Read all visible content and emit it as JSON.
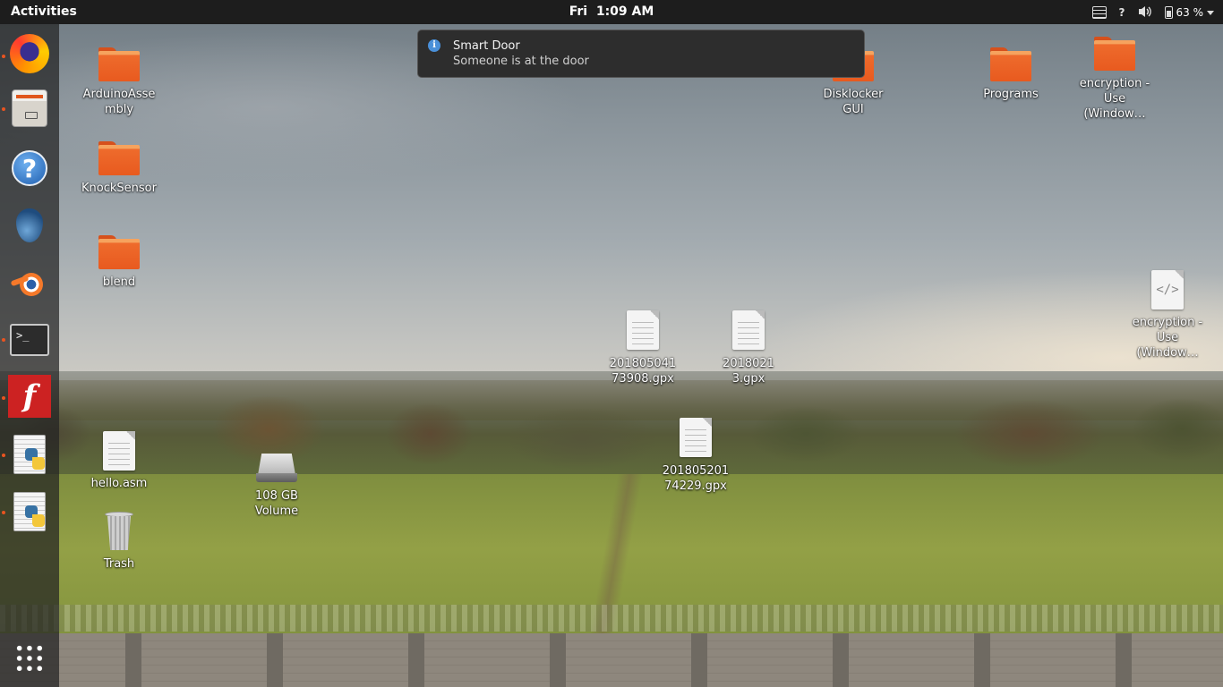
{
  "topbar": {
    "activities": "Activities",
    "clock": "Fri  1:09 AM",
    "help": "?",
    "battery": "63 %"
  },
  "dock": {
    "items": [
      {
        "icon": "firefox-icon"
      },
      {
        "icon": "files-icon"
      },
      {
        "icon": "help-icon",
        "glyph": "?"
      },
      {
        "icon": "drop-icon"
      },
      {
        "icon": "blender-icon"
      },
      {
        "icon": "terminal-icon",
        "glyph": ">_"
      },
      {
        "icon": "fritzing-icon",
        "glyph": "f"
      },
      {
        "icon": "python-file-icon"
      },
      {
        "icon": "python-file-icon"
      }
    ],
    "show_apps_icon": "app-grid-icon"
  },
  "notification": {
    "title": "Smart Door",
    "body": "Someone is at the door",
    "icon": "info-icon"
  },
  "desktop": {
    "arduino_folder": "ArduinoAssembly",
    "knock_folder": "KnockSensor",
    "blend_folder": "blend",
    "hello_file": "hello.asm",
    "volume": "108 GB Volume",
    "trash": "Trash",
    "gpx1": "20180504173908.gpx",
    "gpx2": "20180213.gpx",
    "gpx3": "20180520174229.gpx",
    "disklocker_folder": "Disklocker GUI",
    "programs_folder": "Programs",
    "encryption_folder": "encryption - Use (Window…",
    "encryption_file": "encryption - Use (Window…"
  },
  "colors": {
    "accent": "#e95420",
    "topbar": "#1d1d1d",
    "notification_bg": "#2d2d2d"
  }
}
